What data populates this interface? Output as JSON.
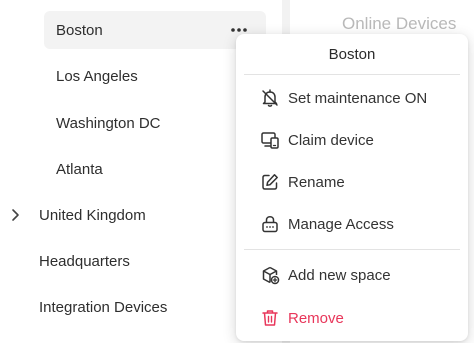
{
  "tree": {
    "items": [
      {
        "label": "Boston"
      },
      {
        "label": "Los Angeles"
      },
      {
        "label": "Washington DC"
      },
      {
        "label": "Atlanta"
      },
      {
        "label": "United Kingdom"
      },
      {
        "label": "Headquarters"
      },
      {
        "label": "Integration Devices"
      }
    ]
  },
  "right_panel": {
    "title": "Online Devices"
  },
  "context_menu": {
    "title": "Boston",
    "items": [
      {
        "label": "Set maintenance ON",
        "icon": "bell-off-icon"
      },
      {
        "label": "Claim device",
        "icon": "devices-icon"
      },
      {
        "label": "Rename",
        "icon": "edit-icon"
      },
      {
        "label": "Manage Access",
        "icon": "lock-icon"
      },
      {
        "label": "Add new space",
        "icon": "cube-add-icon"
      },
      {
        "label": "Remove",
        "icon": "trash-icon"
      }
    ],
    "danger_color": "#e8365a"
  }
}
